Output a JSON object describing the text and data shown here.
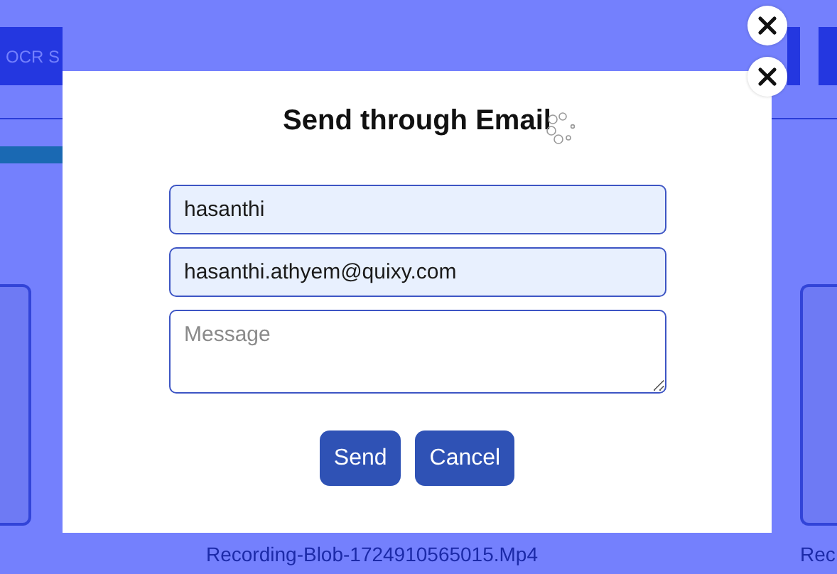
{
  "background": {
    "ocr_button": "OCR S",
    "captions": [
      "Recording-Blob-1724910565015.Mp4",
      "Rec"
    ]
  },
  "modal": {
    "title": "Send through Email",
    "fields": [
      {
        "kind": "input",
        "value": "hasanthi"
      },
      {
        "kind": "input",
        "value": "hasanthi.athyem@quixy.com"
      },
      {
        "kind": "textarea",
        "placeholder": "Message"
      }
    ],
    "buttons": [
      "Send",
      "Cancel"
    ]
  }
}
